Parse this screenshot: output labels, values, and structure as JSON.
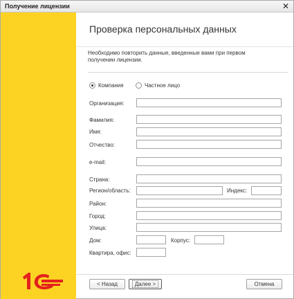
{
  "window": {
    "title": "Получение лицензии",
    "close_glyph": "✕"
  },
  "header": {
    "title": "Проверка персональных данных"
  },
  "note": {
    "line1": "Необходимо повторить данные, введенные вами при первом",
    "line2": "получении лицензии."
  },
  "person_type": {
    "options": [
      "Компания",
      "Частное лицо"
    ],
    "selected": "Компания"
  },
  "form": {
    "organization": {
      "label": "Организация:",
      "value": ""
    },
    "last_name": {
      "label": "Фамилия:",
      "value": ""
    },
    "first_name": {
      "label": "Имя:",
      "value": ""
    },
    "patronymic": {
      "label": "Отчество:",
      "value": ""
    },
    "email": {
      "label": "e-mail:",
      "value": ""
    },
    "country": {
      "label": "Страна:",
      "value": ""
    },
    "region": {
      "label": "Регион/область:",
      "value": ""
    },
    "postal_code": {
      "label": "Индекс:",
      "value": ""
    },
    "district": {
      "label": "Район:",
      "value": ""
    },
    "city": {
      "label": "Город:",
      "value": ""
    },
    "street": {
      "label": "Улица:",
      "value": ""
    },
    "house": {
      "label": "Дом:",
      "value": ""
    },
    "building": {
      "label": "Корпус:",
      "value": ""
    },
    "apartment": {
      "label": "Квартира, офис:",
      "value": ""
    }
  },
  "buttons": {
    "back": "< Назад",
    "next": "Далее >",
    "cancel": "Отмена"
  },
  "brand": {
    "logo_icon": "1c-logo-icon",
    "sidebar_color": "#fcd323",
    "logo_color": "#e4211c"
  }
}
